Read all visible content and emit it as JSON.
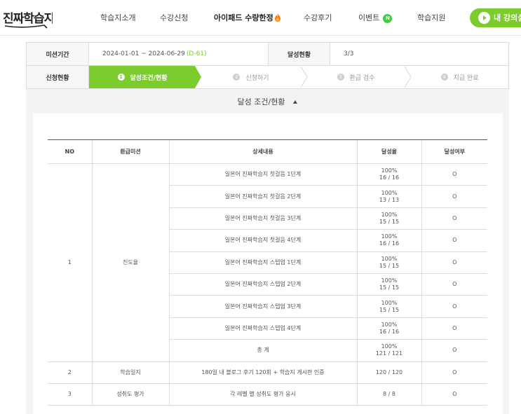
{
  "header": {
    "logo_text": "진짜학습지",
    "nav": [
      {
        "label": "학습지소개"
      },
      {
        "label": "수강신청"
      },
      {
        "label": "아이패드 수량한정"
      },
      {
        "label": "수강후기"
      },
      {
        "label": "이벤트",
        "badge": "N"
      },
      {
        "label": "학습지원"
      }
    ],
    "my_button": "내 강의실",
    "colors": {
      "brand_green": "#7ccc2d",
      "badge_green": "#44cc44",
      "fire": "#ff7a1a"
    }
  },
  "mission": {
    "period_label": "미션기간",
    "period_value": "2024-01-01 ~ 2024-06-29",
    "dday": "(D-61)",
    "achieve_label": "달성현황",
    "achieve_value": "3/3",
    "status_label": "신청현황",
    "steps": [
      {
        "num": "1",
        "label": "달성조건/현황",
        "active": true
      },
      {
        "num": "2",
        "label": "신청하기",
        "active": false
      },
      {
        "num": "3",
        "label": "환급 검수",
        "active": false
      },
      {
        "num": "4",
        "label": "지급 완료",
        "active": false
      }
    ]
  },
  "section": {
    "title": "달성 조건/현황"
  },
  "table": {
    "headers": [
      "NO",
      "환급미션",
      "상세내용",
      "달성율",
      "달성여부"
    ],
    "group1": {
      "no": "1",
      "mission": "진도율",
      "rows": [
        {
          "detail": "일본어 진짜학습지 첫걸음 1단계",
          "rate": "100%",
          "count": "16 / 16",
          "done": "O"
        },
        {
          "detail": "일본어 진짜학습지 첫걸음 2단계",
          "rate": "100%",
          "count": "13 / 13",
          "done": "O"
        },
        {
          "detail": "일본어 진짜학습지 첫걸음 3단계",
          "rate": "100%",
          "count": "15 / 15",
          "done": "O"
        },
        {
          "detail": "일본어 진짜학습지 첫걸음 4단계",
          "rate": "100%",
          "count": "16 / 16",
          "done": "O"
        },
        {
          "detail": "일본어 진짜학습지 스텝업 1단계",
          "rate": "100%",
          "count": "15 / 15",
          "done": "O"
        },
        {
          "detail": "일본어 진짜학습지 스텝업 2단계",
          "rate": "100%",
          "count": "15 / 15",
          "done": "O"
        },
        {
          "detail": "일본어 진짜학습지 스텝업 3단계",
          "rate": "100%",
          "count": "15 / 15",
          "done": "O"
        },
        {
          "detail": "일본어 진짜학습지 스텝업 4단계",
          "rate": "100%",
          "count": "16 / 16",
          "done": "O"
        },
        {
          "detail": "총 계",
          "rate": "100%",
          "count": "121 / 121",
          "done": "O"
        }
      ]
    },
    "row2": {
      "no": "2",
      "mission": "학습일지",
      "detail": "180일 내 블로그 후기 120회 + 학습지 게시판 인증",
      "rate": "120 / 120",
      "done": "O"
    },
    "row3": {
      "no": "3",
      "mission": "성취도 평가",
      "detail": "각 레벨 별 성취도 평가 응시",
      "rate": "8 / 8",
      "done": "O"
    }
  }
}
